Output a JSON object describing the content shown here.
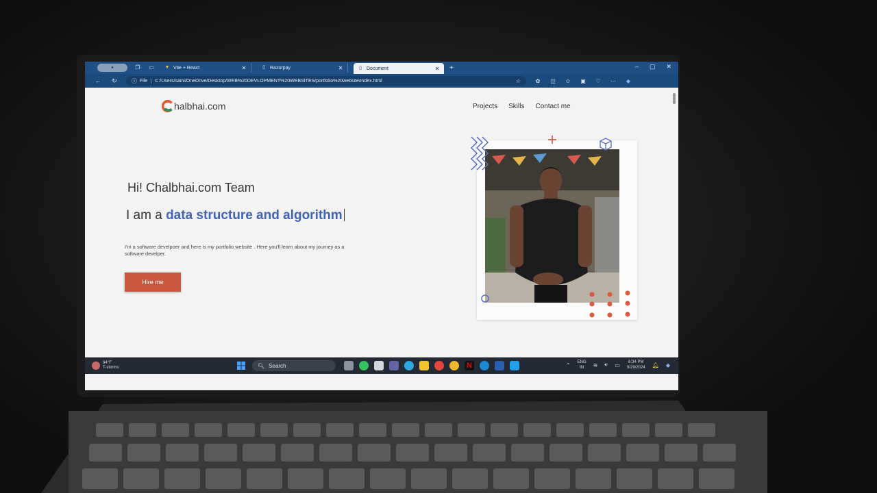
{
  "browser": {
    "tabs": [
      {
        "title": "Vite + React",
        "icon": "vite-logo-icon",
        "active": false
      },
      {
        "title": "Razorpay",
        "icon": "page-icon",
        "active": false
      },
      {
        "title": "Document",
        "icon": "page-icon",
        "active": true
      }
    ],
    "address": {
      "scheme_label": "File",
      "url": "C:/Users/saini/OneDrive/Desktop/WEB%20DEVLOPMENT%20WEBSITES/portfolio%20website/index.html"
    }
  },
  "site": {
    "logo_letter": "C",
    "logo_text": "halbhai.com",
    "nav": [
      "Projects",
      "Skills",
      "Contact me"
    ],
    "greeting": "Hi! Chalbhai.com Team",
    "role_prefix": "I am a ",
    "role_typed": "data structure and algorithm",
    "bio": "I'm a software develpoer and here is my portfolio website . Here you'll learn about my journey as a software develper.",
    "hire_label": "Hire me"
  },
  "taskbar": {
    "weather_temp": "84°F",
    "weather_desc": "T-storms",
    "search_label": "Search",
    "lang_top": "ENG",
    "lang_bottom": "IN",
    "time": "6:34 PM",
    "date": "9/29/2024"
  },
  "colors": {
    "accent_blue": "#3f63b5",
    "button_orange": "#c9563e",
    "browser_frame": "#1f4f84"
  }
}
